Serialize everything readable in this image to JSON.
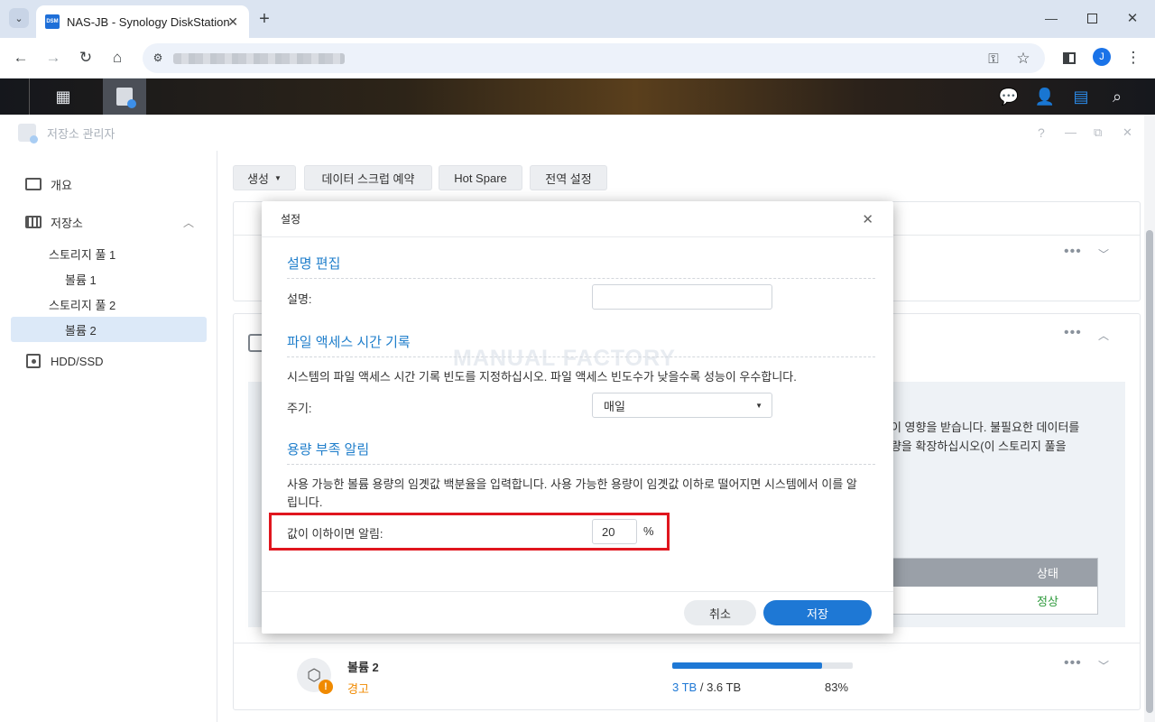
{
  "browser": {
    "tab_title": "NAS-JB - Synology DiskStation",
    "favicon_text": "DSM",
    "profile_initial": "J",
    "new_tab": "+"
  },
  "app": {
    "title": "저장소 관리자",
    "window_controls": [
      "?",
      "—",
      "⧉",
      "✕"
    ]
  },
  "sidebar": {
    "items": [
      {
        "label": "개요"
      },
      {
        "label": "저장소"
      },
      {
        "label": "스토리지 풀 1"
      },
      {
        "label": "볼륨 1"
      },
      {
        "label": "스토리지 풀 2"
      },
      {
        "label": "볼륨 2"
      },
      {
        "label": "HDD/SSD"
      }
    ]
  },
  "toolbar": {
    "create": "생성",
    "scrub": "데이터 스크럽 예약",
    "hotspare": "Hot Spare",
    "global": "전역 설정"
  },
  "background": {
    "warn_line1": "능이 영향을 받습니다. 불필요한 데이터를",
    "warn_line2": "용량을 확장하십시오(이 스토리지 풀을",
    "status_header": "상태",
    "status_value": "정상",
    "volume_name": "볼륨 2",
    "volume_status": "경고",
    "used": "3 TB",
    "separator": "/",
    "total": "3.6 TB",
    "percent": "83%",
    "usage_fraction": 0.83
  },
  "dialog": {
    "title": "설정",
    "watermark": "MANUAL FACTORY",
    "sec_desc": "설명 편집",
    "desc_label": "설명:",
    "desc_value": "",
    "sec_access": "파일 액세스 시간 기록",
    "access_text": "시스템의 파일 액세스 시간 기록 빈도를 지정하십시오. 파일 액세스 빈도수가 낮을수록 성능이 우수합니다.",
    "period_label": "주기:",
    "period_value": "매일",
    "sec_alert": "용량 부족 알림",
    "alert_text": "사용 가능한 볼륨 용량의 임곗값 백분율을 입력합니다. 사용 가능한 용량이 임곗값 이하로 떨어지면 시스템에서 이를 알립니다.",
    "threshold_label": "값이 이하이면 알림:",
    "threshold_value": "20",
    "threshold_unit": "%",
    "cancel": "취소",
    "save": "저장"
  },
  "colors": {
    "accent": "#1e78d5",
    "highlight": "#e0161e",
    "warning": "#f08a00",
    "ok": "#2e9a3c"
  }
}
